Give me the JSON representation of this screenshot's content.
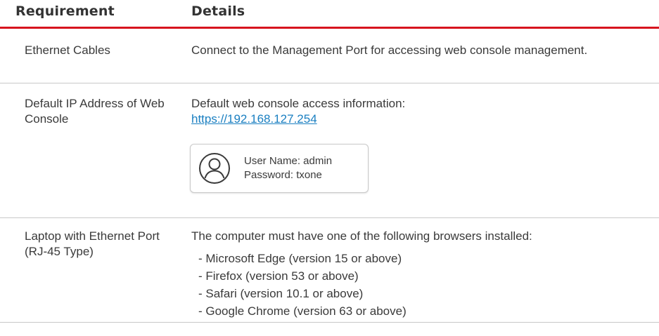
{
  "header": {
    "requirement": "Requirement",
    "details": "Details"
  },
  "rows": [
    {
      "requirement": "Ethernet Cables",
      "details": "Connect to the Management Port for accessing web console management."
    },
    {
      "requirement": "Default IP Address of Web Console",
      "details": "Default web console access information:",
      "link": "https://192.168.127.254",
      "credentials": {
        "icon": "user-icon",
        "user_name": "User Name: admin",
        "password": "Password: txone"
      }
    },
    {
      "requirement": "Laptop with Ethernet Port (RJ-45 Type)",
      "details": "The computer must have one of the following browsers installed:",
      "browsers": [
        "- Microsoft Edge (version 15 or above)",
        "- Firefox (version 53 or above)",
        "- Safari (version 10.1 or above)",
        "- Google Chrome (version 63 or above)"
      ]
    }
  ],
  "colors": {
    "accent_rule": "#d7141e",
    "link": "#1a7fc1",
    "text": "#3a3a3a"
  }
}
